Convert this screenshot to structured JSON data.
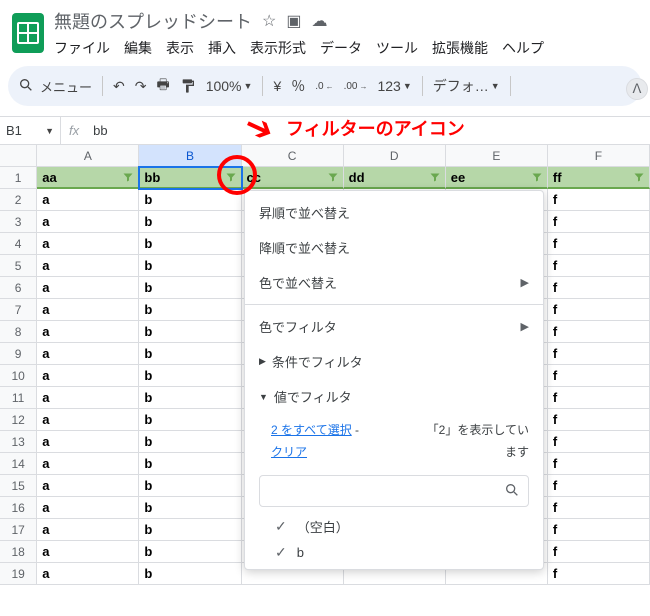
{
  "doc": {
    "title": "無題のスプレッドシート"
  },
  "title_icons": {
    "star": "☆",
    "move": "▣",
    "cloud": "☁"
  },
  "menu": {
    "file": "ファイル",
    "edit": "編集",
    "view": "表示",
    "insert": "挿入",
    "format": "表示形式",
    "data": "データ",
    "tools": "ツール",
    "extensions": "拡張機能",
    "help": "ヘルプ"
  },
  "toolbar": {
    "search_label": "メニュー",
    "zoom": "100%",
    "yen": "¥",
    "pct": "％",
    "dec_dec": ".0",
    "inc_dec": ".00",
    "num123": "123",
    "font": "デフォ…"
  },
  "namebox": {
    "ref": "B1",
    "formula": "bb"
  },
  "columns": [
    "A",
    "B",
    "C",
    "D",
    "E",
    "F"
  ],
  "header_row": [
    "aa",
    "bb",
    "cc",
    "dd",
    "ee",
    "ff"
  ],
  "data_rows": [
    [
      "a",
      "b",
      "",
      "",
      "",
      "f"
    ],
    [
      "a",
      "b",
      "",
      "",
      "",
      "f"
    ],
    [
      "a",
      "b",
      "",
      "",
      "",
      "f"
    ],
    [
      "a",
      "b",
      "",
      "",
      "",
      "f"
    ],
    [
      "a",
      "b",
      "",
      "",
      "",
      "f"
    ],
    [
      "a",
      "b",
      "",
      "",
      "",
      "f"
    ],
    [
      "a",
      "b",
      "",
      "",
      "",
      "f"
    ],
    [
      "a",
      "b",
      "",
      "",
      "",
      "f"
    ],
    [
      "a",
      "b",
      "",
      "",
      "",
      "f"
    ],
    [
      "a",
      "b",
      "",
      "",
      "",
      "f"
    ],
    [
      "a",
      "b",
      "",
      "",
      "",
      "f"
    ],
    [
      "a",
      "b",
      "",
      "",
      "",
      "f"
    ],
    [
      "a",
      "b",
      "",
      "",
      "",
      "f"
    ],
    [
      "a",
      "b",
      "",
      "",
      "",
      "f"
    ],
    [
      "a",
      "b",
      "",
      "",
      "",
      "f"
    ],
    [
      "a",
      "b",
      "",
      "",
      "",
      "f"
    ],
    [
      "a",
      "b",
      "",
      "",
      "",
      "f"
    ],
    [
      "a",
      "b",
      "",
      "",
      "",
      "f"
    ]
  ],
  "filter_menu": {
    "sort_asc": "昇順で並べ替え",
    "sort_desc": "降順で並べ替え",
    "sort_color": "色で並べ替え",
    "filter_color": "色でフィルタ",
    "filter_condition": "条件でフィルタ",
    "filter_value": "値でフィルタ",
    "select_all": "2 をすべて選択",
    "dash": "-",
    "clear": "クリア",
    "showing": "「2」を表示しています",
    "options": {
      "blank": "（空白）",
      "b": "b"
    }
  },
  "annotation": {
    "text": "フィルターのアイコン"
  }
}
